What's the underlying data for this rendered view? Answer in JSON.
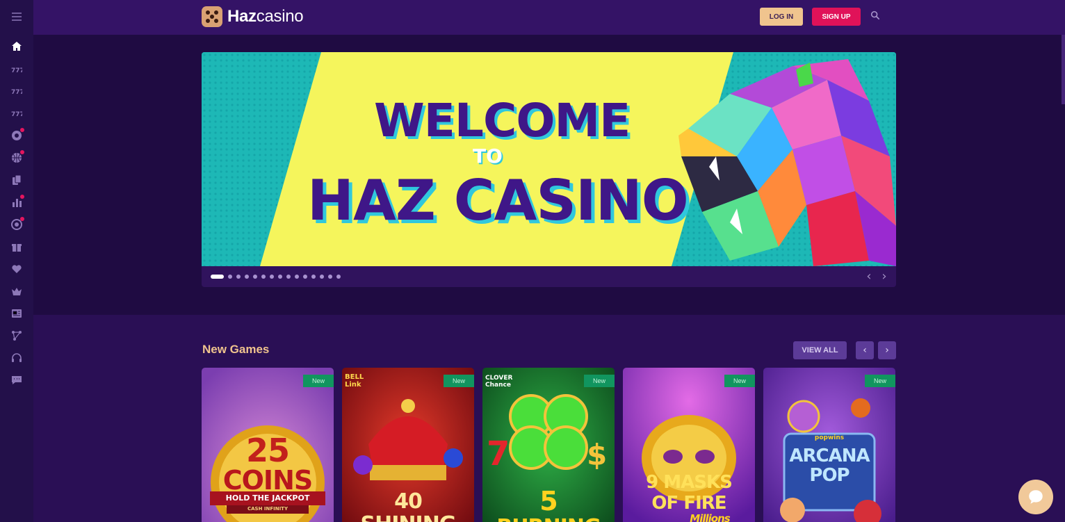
{
  "header": {
    "logo_text_bold": "Haz",
    "logo_text_light": "casino",
    "login_label": "LOG IN",
    "signup_label": "SIGN UP"
  },
  "sidebar": {
    "items": [
      {
        "icon": "home-icon",
        "active": true
      },
      {
        "icon": "slots-777-icon"
      },
      {
        "icon": "slots-777-icon"
      },
      {
        "icon": "slots-777-icon"
      },
      {
        "icon": "live-casino-chip-icon",
        "dot": true
      },
      {
        "icon": "basketball-icon",
        "dot": true
      },
      {
        "icon": "cards-icon"
      },
      {
        "icon": "bar-chart-icon",
        "dot": true
      },
      {
        "icon": "target-icon",
        "dot": true
      },
      {
        "icon": "gift-icon"
      },
      {
        "icon": "heart-icon"
      },
      {
        "icon": "crown-icon"
      },
      {
        "icon": "newspaper-icon"
      },
      {
        "icon": "affiliate-icon"
      },
      {
        "icon": "headset-icon"
      },
      {
        "icon": "chat-bubble-icon"
      }
    ]
  },
  "banner": {
    "line1": "WELCOME",
    "line2": "TO",
    "line3": "HAZ CASINO",
    "slide_count": 15,
    "active_slide": 1,
    "prev_glyph": "‹",
    "next_glyph": "›"
  },
  "new_games": {
    "title": "New Games",
    "view_all_label": "VIEW ALL",
    "prev_glyph": "‹",
    "next_glyph": "›",
    "games": [
      {
        "badge": "New",
        "art_line1": "25",
        "art_line2": "COINS",
        "art_line3": "HOLD THE JACKPOT",
        "art_line4": "CASH INFINITY"
      },
      {
        "badge": "New",
        "art_logo": "BELL Link",
        "art_line1": "40",
        "art_line2": "SHINING"
      },
      {
        "badge": "New",
        "art_logo": "CLOVER Chance",
        "art_line1": "5",
        "art_line2": "BURNING"
      },
      {
        "badge": "New",
        "art_line1": "9 MASKS",
        "art_line2": "OF FIRE",
        "art_line3": "Millions"
      },
      {
        "badge": "New",
        "art_logo": "popwins",
        "art_line1": "ARCANA",
        "art_line2": "POP"
      }
    ]
  },
  "colors": {
    "page_bg": "#2a0f55",
    "topbar_bg": "#341366",
    "sidebar_bg": "#23104a",
    "accent_gold": "#f0c48e",
    "signup_pink": "#e01259",
    "badge_green": "#11955f"
  }
}
